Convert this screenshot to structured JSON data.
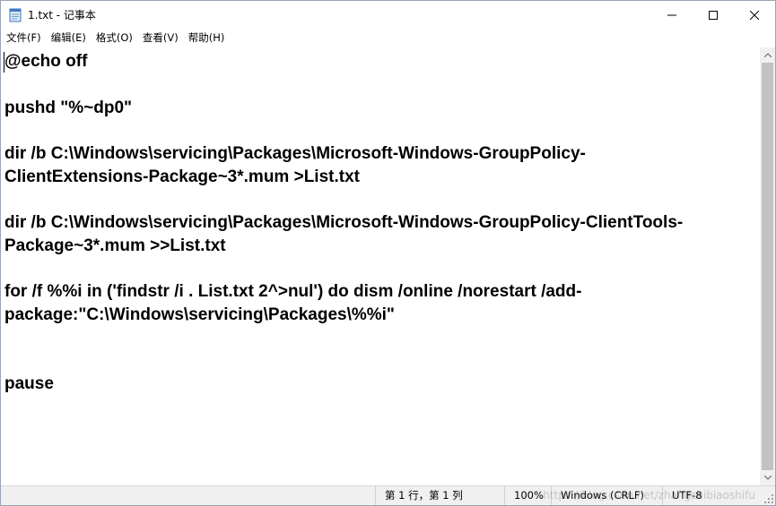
{
  "window": {
    "title": "1.txt - 记事本",
    "app_icon": "notepad-icon",
    "controls": {
      "minimize_icon": "minimize-icon",
      "maximize_icon": "maximize-icon",
      "close_icon": "close-icon"
    }
  },
  "menubar": {
    "items": [
      {
        "label": "文件(F)"
      },
      {
        "label": "编辑(E)"
      },
      {
        "label": "格式(O)"
      },
      {
        "label": "查看(V)"
      },
      {
        "label": "帮助(H)"
      }
    ]
  },
  "editor": {
    "lines": [
      "@echo off",
      "",
      "pushd \"%~dp0\"",
      "",
      "dir /b C:\\Windows\\servicing\\Packages\\Microsoft-Windows-GroupPolicy-",
      "ClientExtensions-Package~3*.mum >List.txt",
      "",
      "dir /b C:\\Windows\\servicing\\Packages\\Microsoft-Windows-GroupPolicy-ClientTools-",
      "Package~3*.mum >>List.txt",
      "",
      "for /f %%i in ('findstr /i . List.txt 2^>nul') do dism /online /norestart /add-",
      "package:\"C:\\Windows\\servicing\\Packages\\%%i\"",
      "",
      "",
      "pause"
    ]
  },
  "statusbar": {
    "position": "第 1 行，第 1 列",
    "zoom": "100%",
    "line_ending": "Windows (CRLF)",
    "encoding": "UTF-8",
    "watermark": "https://blog.csdn.net/zhangshibiaoshifu"
  },
  "colors": {
    "text": "#000000",
    "background": "#ffffff",
    "statusbar_bg": "#f0f0f0",
    "scrollbar_thumb": "#c2c2c2"
  }
}
